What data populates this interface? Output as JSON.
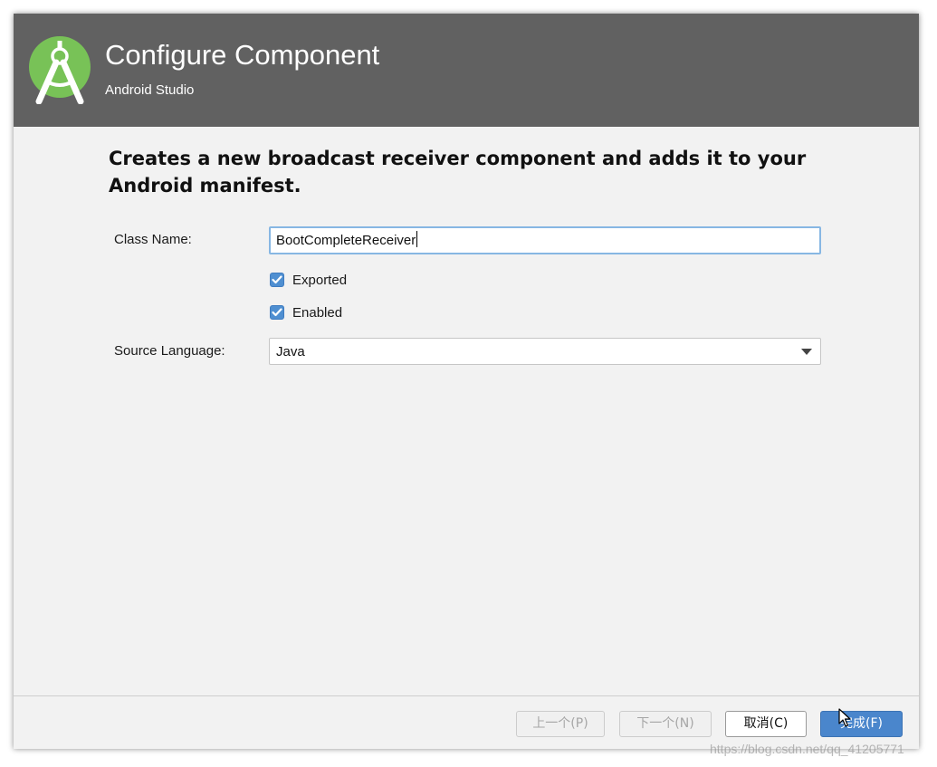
{
  "header": {
    "title": "Configure Component",
    "subtitle": "Android Studio",
    "logo_icon": "android-studio-logo-icon",
    "background_color": "#616161",
    "logo_color": "#78c257"
  },
  "description": "Creates a new broadcast receiver component and adds it to your Android manifest.",
  "form": {
    "class_name": {
      "label": "Class Name:",
      "value": "BootCompleteReceiver"
    },
    "exported": {
      "label": "Exported",
      "checked": true
    },
    "enabled": {
      "label": "Enabled",
      "checked": true
    },
    "source_language": {
      "label": "Source Language:",
      "selected": "Java"
    }
  },
  "buttons": {
    "previous": "上一个(P)",
    "next": "下一个(N)",
    "cancel": "取消(C)",
    "finish": "完成(F)"
  },
  "accent_color": "#4a86cc",
  "watermark": "https://blog.csdn.net/qq_41205771"
}
